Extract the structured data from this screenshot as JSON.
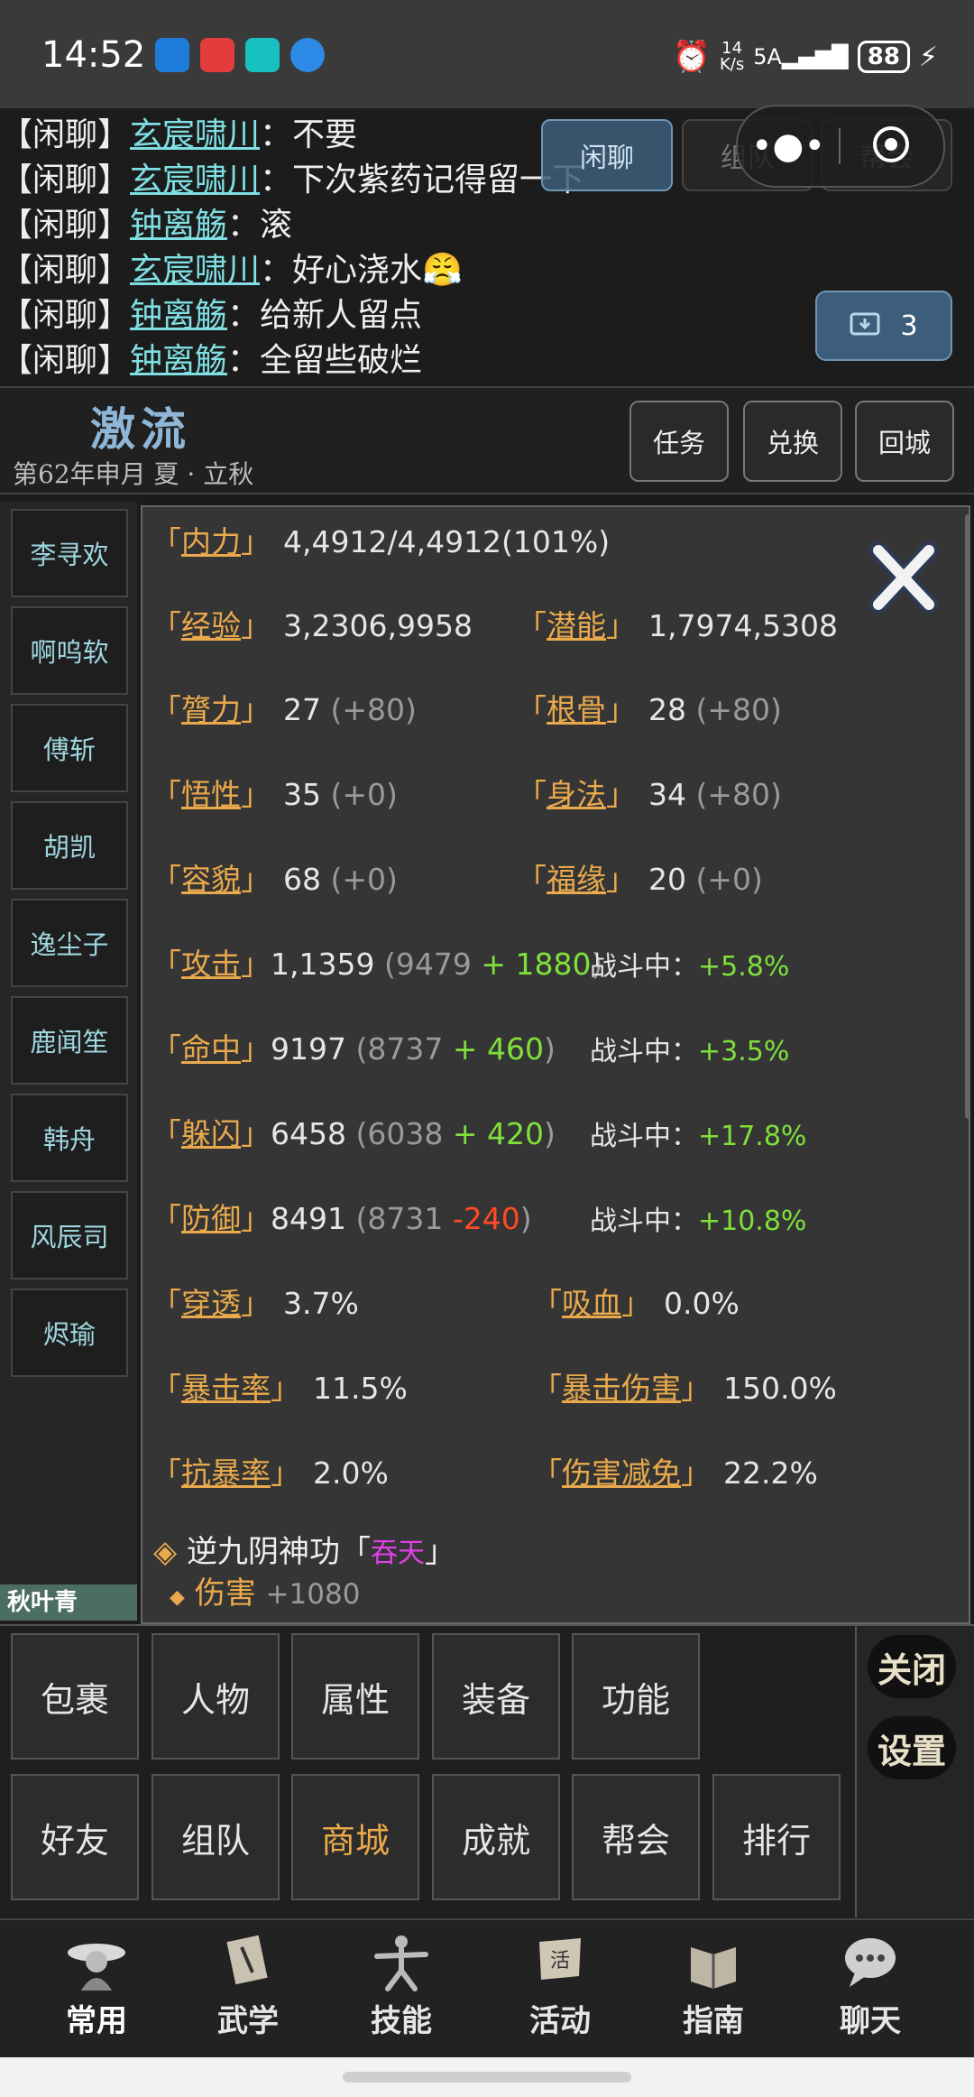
{
  "status": {
    "time": "14:52",
    "net_speed_top": "14",
    "net_speed_bottom": "K/s",
    "signal": "5A",
    "battery": "88"
  },
  "chat": {
    "lines": [
      {
        "tag": "【闲聊】",
        "name": "玄宸啸川",
        "sep": "：",
        "text": "不要"
      },
      {
        "tag": "【闲聊】",
        "name": "玄宸啸川",
        "sep": "：",
        "text": "下次紫药记得留一下"
      },
      {
        "tag": "【闲聊】",
        "name": "钟离觞",
        "sep": "：",
        "text": "滚"
      },
      {
        "tag": "【闲聊】",
        "name": "玄宸啸川",
        "sep": "：",
        "text": "好心浇水😤"
      },
      {
        "tag": "【闲聊】",
        "name": "钟离觞",
        "sep": "：",
        "text": "给新人留点"
      },
      {
        "tag": "【闲聊】",
        "name": "钟离觞",
        "sep": "：",
        "text": "全留些破烂"
      }
    ],
    "tabs": [
      "闲聊",
      "组队",
      "帮会"
    ],
    "inbox_count": "3"
  },
  "header": {
    "scene": "激流",
    "date": "第62年申月 夏 · 立秋",
    "buttons": [
      "任务",
      "兑换",
      "回城"
    ]
  },
  "players": [
    "李寻欢",
    "啊呜软",
    "傅斩",
    "胡凯",
    "逸尘子",
    "鹿闻笙",
    "韩舟",
    "风辰司",
    "烬瑜"
  ],
  "current_player": "秋叶青",
  "attributes": {
    "neili": {
      "label": "内力",
      "value": "4,4912/4,4912(101%)"
    },
    "jingyan": {
      "label": "经验",
      "value": "3,2306,9958"
    },
    "qianneng": {
      "label": "潜能",
      "value": "1,7974,5308"
    },
    "stats": [
      {
        "label": "膂力",
        "value": "27",
        "bonus": "(+80)"
      },
      {
        "label": "根骨",
        "value": "28",
        "bonus": "(+80)"
      },
      {
        "label": "悟性",
        "value": "35",
        "bonus": "(+0)"
      },
      {
        "label": "身法",
        "value": "34",
        "bonus": "(+80)"
      },
      {
        "label": "容貌",
        "value": "68",
        "bonus": "(+0)"
      },
      {
        "label": "福缘",
        "value": "20",
        "bonus": "(+0)"
      }
    ],
    "combat": [
      {
        "label": "攻击",
        "value": "1,1359",
        "base": "(9479",
        "plus": "+ 1880",
        "close": ")",
        "fight_label": "战斗中：",
        "fight": "+5.8%"
      },
      {
        "label": "命中",
        "value": "9197",
        "base": "(8737",
        "plus": "+ 460",
        "close": ")",
        "fight_label": "战斗中：",
        "fight": "+3.5%"
      },
      {
        "label": "躲闪",
        "value": "6458",
        "base": "(6038",
        "plus": "+ 420",
        "close": ")",
        "fight_label": "战斗中：",
        "fight": "+17.8%"
      },
      {
        "label": "防御",
        "value": "8491",
        "base": "(8731",
        "plus": "-240",
        "close": ")",
        "fight_label": "战斗中：",
        "fight": "+10.8%"
      }
    ],
    "extra": [
      {
        "label": "穿透",
        "value": "3.7%"
      },
      {
        "label": "吸血",
        "value": "0.0%"
      },
      {
        "label": "暴击率",
        "value": "11.5%"
      },
      {
        "label": "暴击伤害",
        "value": "150.0%"
      },
      {
        "label": "抗暴率",
        "value": "2.0%"
      },
      {
        "label": "伤害减免",
        "value": "22.2%"
      }
    ],
    "skill": {
      "name": "逆九阴神功",
      "quote_open": "「",
      "realm": "吞天",
      "quote_close": "」",
      "effect_label": "伤害",
      "effect_value": "+1080"
    }
  },
  "menu": {
    "row1": [
      "包裹",
      "人物",
      "属性",
      "装备",
      "功能"
    ],
    "row2": [
      "好友",
      "组队",
      "商城",
      "成就",
      "帮会",
      "排行"
    ],
    "side": [
      "关闭",
      "设置"
    ],
    "highlight": "商城"
  },
  "nav": [
    "常用",
    "武学",
    "技能",
    "活动",
    "指南",
    "聊天"
  ],
  "colors": {
    "accent": "#e9a94c",
    "name": "#7fdfe3",
    "green": "#7fe03c",
    "magenta": "#e040e8",
    "red": "#ff4a25"
  }
}
